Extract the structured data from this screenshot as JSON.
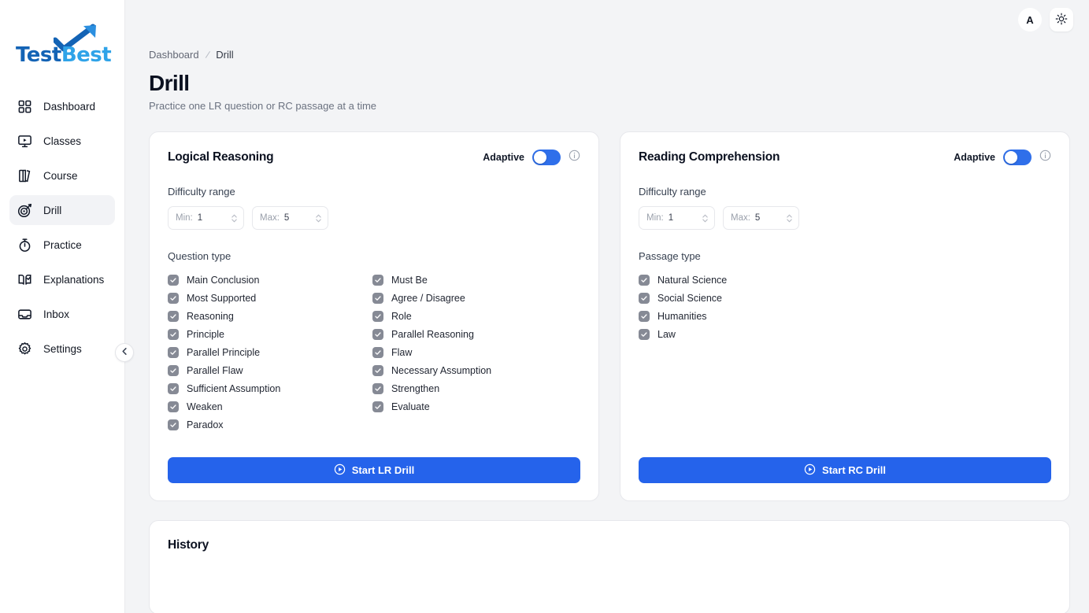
{
  "brand": {
    "logo_text_primary": "Test",
    "logo_text_secondary": "Best",
    "logo_icon": "check-arrow-icon"
  },
  "sidebar": {
    "items": [
      {
        "label": "Dashboard",
        "icon": "grid-icon",
        "active": false
      },
      {
        "label": "Classes",
        "icon": "monitor-play-icon",
        "active": false
      },
      {
        "label": "Course",
        "icon": "books-icon",
        "active": false
      },
      {
        "label": "Drill",
        "icon": "target-icon",
        "active": true
      },
      {
        "label": "Practice",
        "icon": "stopwatch-icon",
        "active": false
      },
      {
        "label": "Explanations",
        "icon": "book-check-icon",
        "active": false
      },
      {
        "label": "Inbox",
        "icon": "inbox-icon",
        "active": false
      },
      {
        "label": "Settings",
        "icon": "gear-icon",
        "active": false
      }
    ],
    "collapse_icon": "chevron-left-icon"
  },
  "topbar": {
    "font_size_label": "A",
    "theme_icon": "sun-icon"
  },
  "breadcrumb": {
    "root": "Dashboard",
    "separator": "/",
    "current": "Drill"
  },
  "header": {
    "title": "Drill",
    "subtitle": "Practice one LR question or RC passage at a time"
  },
  "lr_card": {
    "title": "Logical Reasoning",
    "adaptive_label": "Adaptive",
    "adaptive_on": true,
    "info_icon": "info-circle-icon",
    "difficulty_label": "Difficulty range",
    "min_tag": "Min:",
    "min_value": "1",
    "max_tag": "Max:",
    "max_value": "5",
    "types_label": "Question type",
    "types_left": [
      {
        "label": "Main Conclusion",
        "checked": true
      },
      {
        "label": "Most Supported",
        "checked": true
      },
      {
        "label": "Reasoning",
        "checked": true
      },
      {
        "label": "Principle",
        "checked": true
      },
      {
        "label": "Parallel Principle",
        "checked": true
      },
      {
        "label": "Parallel Flaw",
        "checked": true
      },
      {
        "label": "Sufficient Assumption",
        "checked": true
      },
      {
        "label": "Weaken",
        "checked": true
      },
      {
        "label": "Paradox",
        "checked": true
      }
    ],
    "types_right": [
      {
        "label": "Must Be",
        "checked": true
      },
      {
        "label": "Agree / Disagree",
        "checked": true
      },
      {
        "label": "Role",
        "checked": true
      },
      {
        "label": "Parallel Reasoning",
        "checked": true
      },
      {
        "label": "Flaw",
        "checked": true
      },
      {
        "label": "Necessary Assumption",
        "checked": true
      },
      {
        "label": "Strengthen",
        "checked": true
      },
      {
        "label": "Evaluate",
        "checked": true
      }
    ],
    "start_label": "Start LR Drill",
    "start_icon": "play-circle-icon"
  },
  "rc_card": {
    "title": "Reading Comprehension",
    "adaptive_label": "Adaptive",
    "adaptive_on": true,
    "info_icon": "info-circle-icon",
    "difficulty_label": "Difficulty range",
    "min_tag": "Min:",
    "min_value": "1",
    "max_tag": "Max:",
    "max_value": "5",
    "types_label": "Passage type",
    "types": [
      {
        "label": "Natural Science",
        "checked": true
      },
      {
        "label": "Social Science",
        "checked": true
      },
      {
        "label": "Humanities",
        "checked": true
      },
      {
        "label": "Law",
        "checked": true
      }
    ],
    "start_label": "Start RC Drill",
    "start_icon": "play-circle-icon"
  },
  "history": {
    "title": "History"
  },
  "colors": {
    "accent": "#2563eb",
    "switch_on": "#2f6fea",
    "page_bg": "#f3f4f6",
    "card_bg": "#ffffff",
    "checkbox": "#868a95",
    "logo_dark": "#1363b5",
    "logo_light": "#2fa3e8"
  }
}
